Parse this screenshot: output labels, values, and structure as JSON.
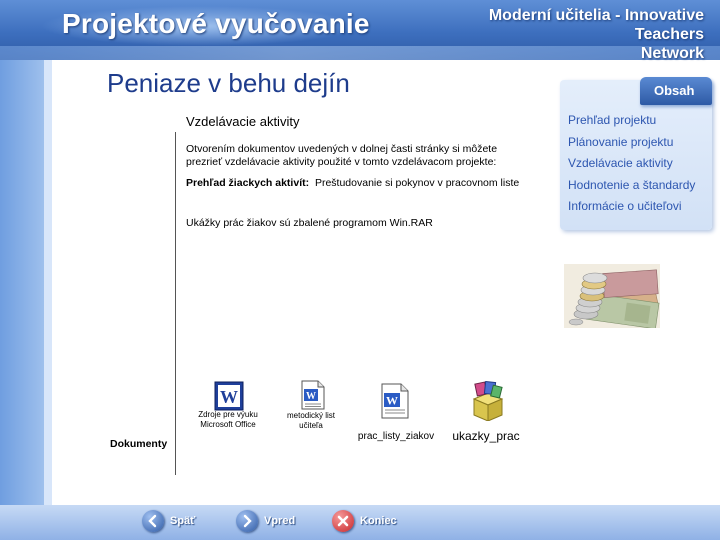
{
  "header": {
    "title": "Projektové vyučovanie",
    "sub_line1": "Moderní učitelia - Innovative",
    "sub_line2": "Teachers",
    "sub_line3": "Network"
  },
  "page": {
    "title": "Peniaze v behu dejín",
    "section_heading": "Vzdelávacie aktivity",
    "intro": "Otvorením dokumentov uvedených v dolnej časti stránky si môžete prezrieť vzdelávacie aktivity použité v tomto vzdelávacom projekte:",
    "overview_label": "Prehľad žiackych aktivít:",
    "overview_text": "Preštudovanie si pokynov v pracovnom liste",
    "rar_note": "Ukážky prác žiakov sú zbalené programom Win.RAR",
    "documents_label": "Dokumenty"
  },
  "sidebar": {
    "tab_label": "Obsah",
    "items": [
      {
        "label": "Prehľad projektu"
      },
      {
        "label": "Plánovanie projektu"
      },
      {
        "label": "Vzdelávacie aktivity"
      },
      {
        "label": "Hodnotenie a štandardy"
      },
      {
        "label": "Informácie o učiteľovi"
      }
    ]
  },
  "documents": [
    {
      "caption_line1": "Zdroje pre výuku",
      "caption_line2": "Microsoft Office",
      "icon": "word-document-icon"
    },
    {
      "caption_line1": "metodický list",
      "caption_line2": "učiteľa",
      "icon": "word-file-icon"
    },
    {
      "caption_line1": "prac_listy_ziakov",
      "caption_line2": "",
      "icon": "word-file-icon"
    },
    {
      "caption_line1": "ukazky_prac",
      "caption_line2": "",
      "icon": "winrar-archive-icon"
    }
  ],
  "footer": {
    "back_label": "Späť",
    "forward_label": "Vpred",
    "end_label": "Koniec"
  },
  "colors": {
    "header_blue": "#3d6fbe",
    "title_blue": "#1e3c8c",
    "link_blue": "#2d56b0",
    "nav_button_blue": "#2e5aa5",
    "end_button_red": "#c8262a"
  }
}
